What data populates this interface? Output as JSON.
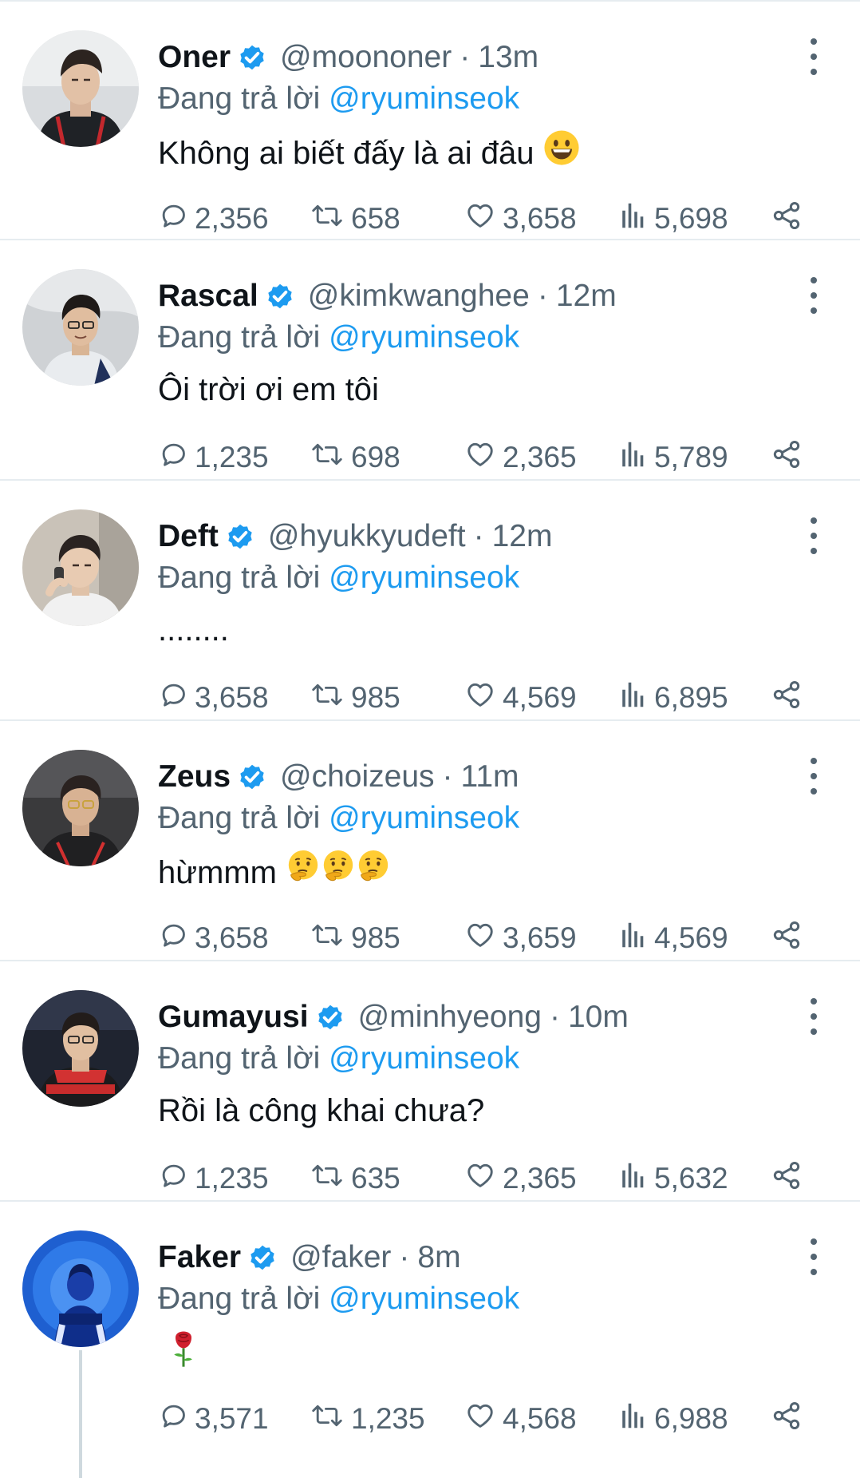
{
  "colors": {
    "link": "#1d9bf0",
    "verified": "#1d9bf0",
    "secondary_text": "#536471",
    "primary_text": "#0f1419",
    "divider": "#e6ecf0"
  },
  "icons": {
    "reply": "speech-bubble-icon",
    "retweet": "retweet-icon",
    "like": "heart-icon",
    "views": "bar-chart-icon",
    "share": "share-icon",
    "menu": "more-vertical-icon",
    "verified": "verified-badge-icon"
  },
  "tweets": [
    {
      "name": "Oner",
      "handle": "@moononer",
      "separator": "·",
      "time": "13m",
      "reply_prefix": "Đang trả lời",
      "reply_to": "@ryuminseok",
      "text": "Không ai biết đấy là ai đâu",
      "emoji": [
        "grinning-face"
      ],
      "replies": "2,356",
      "retweets": "658",
      "likes": "3,658",
      "views": "5,698"
    },
    {
      "name": "Rascal",
      "handle": "@kimkwanghee",
      "separator": "·",
      "time": "12m",
      "reply_prefix": "Đang trả lời",
      "reply_to": "@ryuminseok",
      "text": "Ôi trời ơi em tôi",
      "emoji": [],
      "replies": "1,235",
      "retweets": "698",
      "likes": "2,365",
      "views": "5,789"
    },
    {
      "name": "Deft",
      "handle": "@hyukkyudeft",
      "separator": "·",
      "time": "12m",
      "reply_prefix": "Đang trả lời",
      "reply_to": "@ryuminseok",
      "text": "........",
      "emoji": [],
      "replies": "3,658",
      "retweets": "985",
      "likes": "4,569",
      "views": "6,895"
    },
    {
      "name": "Zeus",
      "handle": "@choizeus",
      "separator": "·",
      "time": "11m",
      "reply_prefix": "Đang trả lời",
      "reply_to": "@ryuminseok",
      "text": "hừmmm",
      "emoji": [
        "thinking-face",
        "thinking-face",
        "thinking-face"
      ],
      "replies": "3,658",
      "retweets": "985",
      "likes": "3,659",
      "views": "4,569"
    },
    {
      "name": "Gumayusi",
      "handle": "@minhyeong",
      "separator": "·",
      "time": "10m",
      "reply_prefix": "Đang trả lời",
      "reply_to": "@ryuminseok",
      "text": "Rồi là công khai chưa?",
      "emoji": [],
      "replies": "1,235",
      "retweets": "635",
      "likes": "2,365",
      "views": "5,632"
    },
    {
      "name": "Faker",
      "handle": "@faker",
      "separator": "·",
      "time": "8m",
      "reply_prefix": "Đang trả lời",
      "reply_to": "@ryuminseok",
      "text": "",
      "emoji": [
        "rose"
      ],
      "replies": "3,571",
      "retweets": "1,235",
      "likes": "4,568",
      "views": "6,988"
    }
  ]
}
